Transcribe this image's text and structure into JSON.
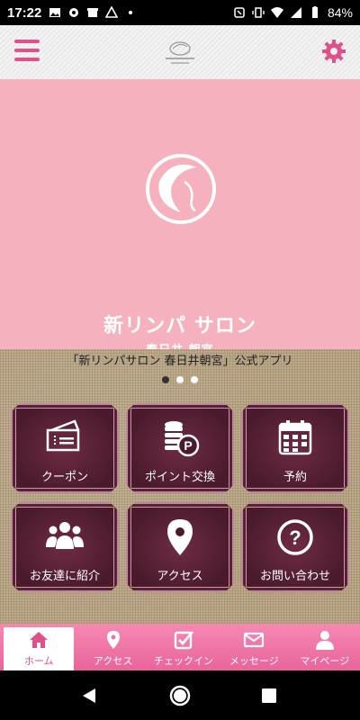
{
  "status_bar": {
    "time": "17:22",
    "battery": "84%"
  },
  "header": {
    "menu_icon": "hamburger-menu-icon",
    "settings_icon": "gear-icon",
    "accent_color": "#e0518b"
  },
  "hero": {
    "title": "新リンパ サロン",
    "subtitle": "春日井 朝宮",
    "background": "#f6b1be"
  },
  "caption": "「新リンパサロン 春日井朝宮」公式アプリ",
  "carousel": {
    "page_count": 3,
    "active_index": 0
  },
  "tiles": [
    {
      "label": "クーポン",
      "icon": "ticket-icon"
    },
    {
      "label": "ポイント交換",
      "icon": "coin-stack-icon"
    },
    {
      "label": "予約",
      "icon": "calendar-icon"
    },
    {
      "label": "お友達に紹介",
      "icon": "group-icon"
    },
    {
      "label": "アクセス",
      "icon": "map-pin-icon"
    },
    {
      "label": "お問い合わせ",
      "icon": "question-icon"
    }
  ],
  "bottom_nav": [
    {
      "label": "ホーム",
      "icon": "home-icon",
      "active": true
    },
    {
      "label": "アクセス",
      "icon": "map-pin-icon",
      "active": false
    },
    {
      "label": "チェックイン",
      "icon": "checkbox-icon",
      "active": false
    },
    {
      "label": "メッセージ",
      "icon": "envelope-icon",
      "active": false
    },
    {
      "label": "マイページ",
      "icon": "person-icon",
      "active": false
    }
  ]
}
